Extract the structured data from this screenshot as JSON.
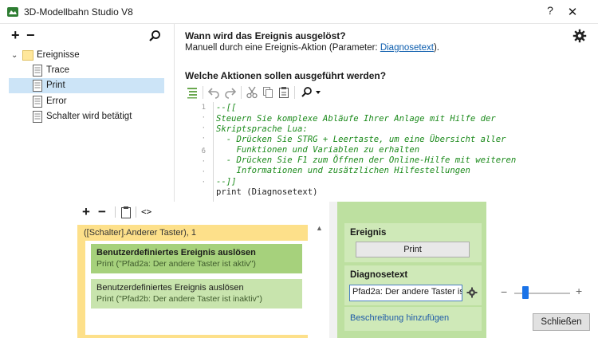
{
  "window": {
    "title": "3D-Modellbahn Studio V8",
    "help_label": "?",
    "close_label": "✕"
  },
  "left_panel": {
    "add_label": "+",
    "remove_label": "−",
    "tree": {
      "root": "Ereignisse",
      "items": [
        "Trace",
        "Print",
        "Error",
        "Schalter wird betätigt"
      ],
      "selected_index": 1
    }
  },
  "event": {
    "question": "Wann wird das Ereignis ausgelöst?",
    "trigger_prefix": "Manuell durch eine Ereignis-Aktion (Parameter: ",
    "trigger_link": "Diagnosetext",
    "trigger_suffix": ").",
    "actions_heading": "Welche Aktionen sollen ausgeführt werden?"
  },
  "editor": {
    "gutter_marks": [
      "1",
      "·",
      "·",
      "·",
      "·",
      "6",
      "·",
      "·",
      "·"
    ],
    "lines": [
      {
        "text": "--[[",
        "kind": "comment"
      },
      {
        "text": "Steuern Sie komplexe Abläufe Ihrer Anlage mit Hilfe der",
        "kind": "comment"
      },
      {
        "text": "Skriptsprache Lua:",
        "kind": "comment"
      },
      {
        "text": "  - Drücken Sie STRG + Leertaste, um eine Übersicht aller",
        "kind": "comment"
      },
      {
        "text": "    Funktionen und Variablen zu erhalten",
        "kind": "comment"
      },
      {
        "text": "  - Drücken Sie F1 zum Öffnen der Online-Hilfe mit weiteren",
        "kind": "comment"
      },
      {
        "text": "    Informationen und zusätzlichen Hilfestellungen",
        "kind": "comment"
      },
      {
        "text": "--]]",
        "kind": "comment"
      },
      {
        "text": "print (Diagnosetext)",
        "kind": "code"
      }
    ]
  },
  "overlay": {
    "toolbar": {
      "add_label": "+",
      "remove_label": "−",
      "code_label": "<>"
    },
    "group_header": "([Schalter].Anderer Taster), 1",
    "actions": [
      {
        "title": "Benutzerdefiniertes Ereignis auslösen",
        "subtitle": "Print (\"Pfad2a:  Der andere Taster ist aktiv\")"
      },
      {
        "title": "Benutzerdefiniertes Ereignis auslösen",
        "subtitle": "Print (\"Pfad2b:  Der andere Taster ist inaktiv\")"
      }
    ],
    "panel": {
      "event_label": "Ereignis",
      "event_value": "Print",
      "param_label": "Diagnosetext",
      "param_value": "Pfad2a:  Der andere Taster ist",
      "add_description": "Beschreibung hinzufügen"
    }
  },
  "zoom": {
    "minus": "−",
    "plus": "+",
    "level": 0.2
  },
  "footer": {
    "close_label": "Schließen"
  },
  "colors": {
    "selection": "#cce4f7",
    "comment": "#1b8a1b",
    "group_yellow": "#fde08a",
    "action_green": "#a6d17c",
    "panel_green": "#bde0a0",
    "link": "#0b5cad",
    "zoom_accent": "#1a73e8"
  }
}
